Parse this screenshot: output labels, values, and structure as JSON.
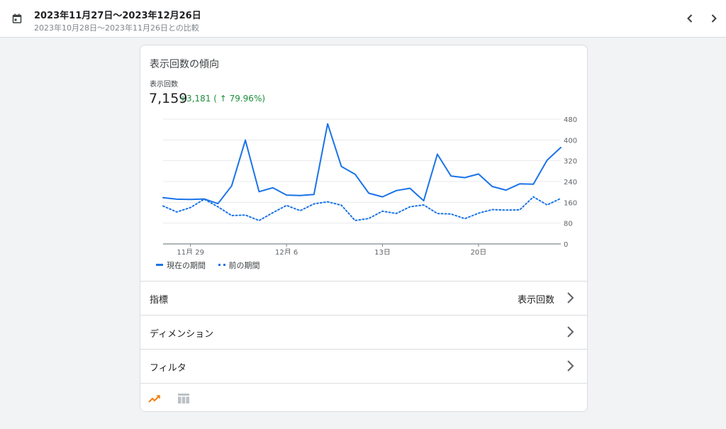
{
  "header": {
    "date_range": "2023年11月27日〜2023年12月26日",
    "comparison": "2023年10月28日〜2023年11月26日との比較",
    "icons": {
      "calendar": "calendar-icon",
      "prev": "chevron-left-icon",
      "next": "chevron-right-icon"
    }
  },
  "card": {
    "title": "表示回数の傾向",
    "metric_label": "表示回数",
    "metric_value": "7,159",
    "metric_change": "+3,181 ( ↑ 79.96%)",
    "change_color": "#1e8e3e"
  },
  "chart_data": {
    "type": "line",
    "x": [
      "11/27",
      "11/28",
      "11/29",
      "11/30",
      "12/1",
      "12/2",
      "12/3",
      "12/4",
      "12/5",
      "12/6",
      "12/7",
      "12/8",
      "12/9",
      "12/10",
      "12/11",
      "12/12",
      "12/13",
      "12/14",
      "12/15",
      "12/16",
      "12/17",
      "12/18",
      "12/19",
      "12/20",
      "12/21",
      "12/22",
      "12/23",
      "12/24",
      "12/25",
      "12/26"
    ],
    "x_tick_labels": [
      {
        "index": 2,
        "label": "11月 29"
      },
      {
        "index": 9,
        "label": "12月 6"
      },
      {
        "index": 16,
        "label": "13日"
      },
      {
        "index": 23,
        "label": "20日"
      }
    ],
    "series": [
      {
        "name": "現在の期間",
        "style": "solid",
        "color": "#1a73e8",
        "values": [
          178,
          172,
          171,
          173,
          155,
          223,
          399,
          201,
          216,
          188,
          186,
          190,
          462,
          298,
          268,
          195,
          181,
          205,
          214,
          166,
          345,
          261,
          255,
          269,
          221,
          207,
          231,
          230,
          322,
          371
        ]
      },
      {
        "name": "前の期間",
        "style": "dotted",
        "color": "#1a73e8",
        "values": [
          146,
          123,
          140,
          172,
          143,
          109,
          111,
          90,
          120,
          148,
          128,
          154,
          162,
          149,
          90,
          98,
          126,
          117,
          143,
          150,
          117,
          115,
          97,
          118,
          132,
          130,
          131,
          181,
          150,
          175
        ]
      }
    ],
    "yticks": [
      0,
      80,
      160,
      240,
      320,
      400,
      480
    ],
    "ylim": [
      0,
      480
    ],
    "grid": true
  },
  "legend": {
    "current": "現在の期間",
    "previous": "前の期間"
  },
  "rows": {
    "metric": {
      "label": "指標",
      "value": "表示回数"
    },
    "dimension": {
      "label": "ディメンション"
    },
    "filter": {
      "label": "フィルタ"
    }
  },
  "footer": {
    "accent": "#f57c00",
    "icons": {
      "line": "line-chart-icon",
      "table": "table-icon"
    }
  }
}
